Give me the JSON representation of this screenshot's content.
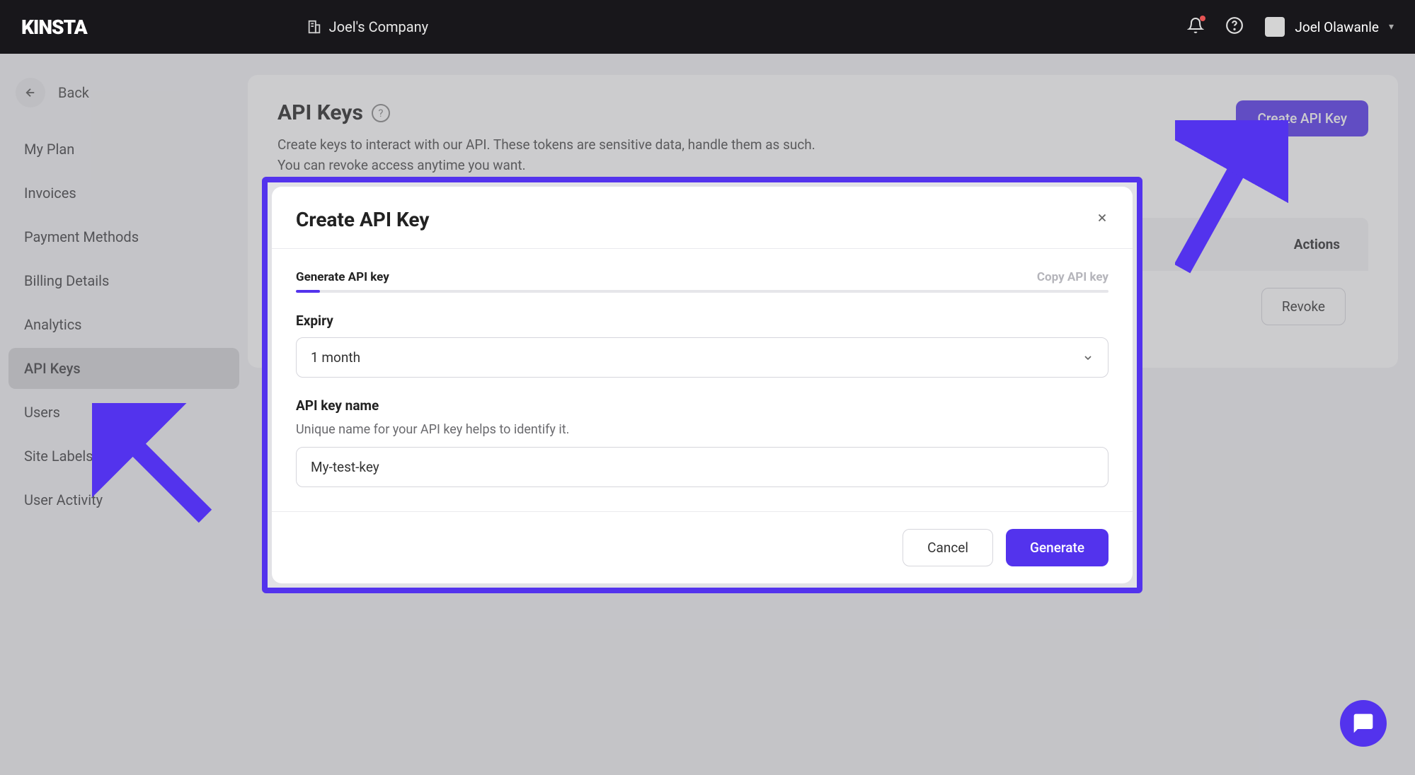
{
  "topbar": {
    "logo": "KINSTA",
    "company": "Joel's Company",
    "user_name": "Joel Olawanle"
  },
  "sidebar": {
    "back_label": "Back",
    "items": [
      {
        "label": "My Plan"
      },
      {
        "label": "Invoices"
      },
      {
        "label": "Payment Methods"
      },
      {
        "label": "Billing Details"
      },
      {
        "label": "Analytics"
      },
      {
        "label": "API Keys"
      },
      {
        "label": "Users"
      },
      {
        "label": "Site Labels"
      },
      {
        "label": "User Activity"
      }
    ],
    "active_index": 5
  },
  "page": {
    "title": "API Keys",
    "subtitle_line1": "Create keys to interact with our API. These tokens are sensitive data, handle them as such.",
    "subtitle_line2": "You can revoke access anytime you want.",
    "create_button": "Create API Key",
    "table": {
      "actions_header": "Actions",
      "revoke_label": "Revoke"
    }
  },
  "modal": {
    "title": "Create API Key",
    "step1": "Generate API key",
    "step2": "Copy API key",
    "expiry_label": "Expiry",
    "expiry_value": "1 month",
    "name_label": "API key name",
    "name_hint": "Unique name for your API key helps to identify it.",
    "name_value": "My-test-key",
    "cancel_label": "Cancel",
    "generate_label": "Generate"
  }
}
